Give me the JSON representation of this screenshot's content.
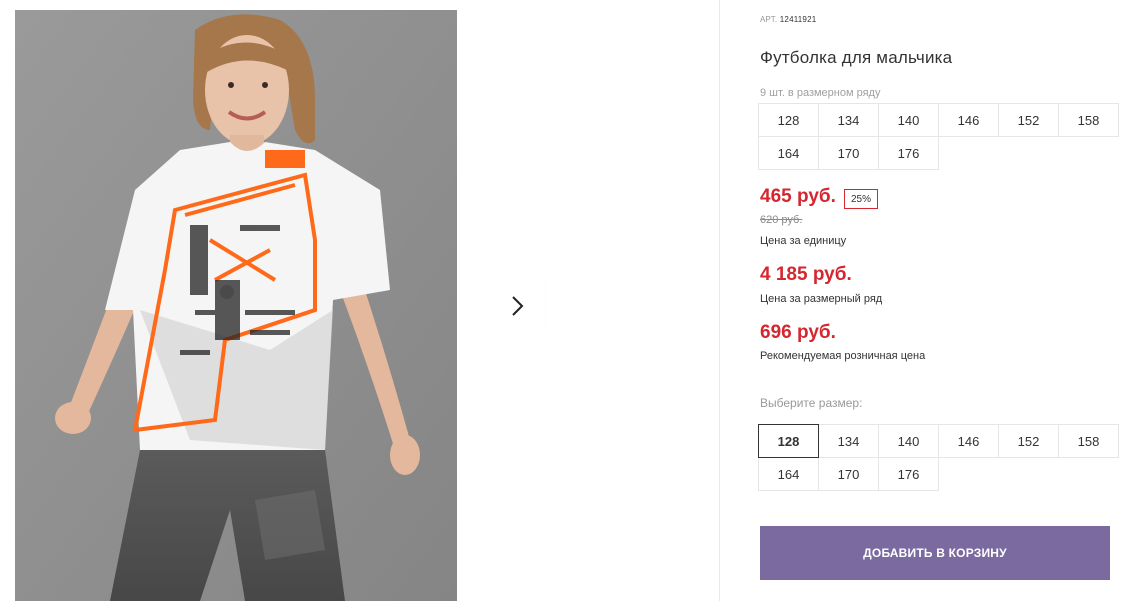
{
  "product": {
    "article_label": "АРТ.",
    "article_number": "12411921",
    "title": "Футболка для мальчика",
    "pack_count_label": "9 шт. в размерном ряду",
    "pack_sizes": [
      "128",
      "134",
      "140",
      "146",
      "152",
      "158",
      "164",
      "170",
      "176"
    ]
  },
  "prices": {
    "unit_price": "465 руб.",
    "discount": "25%",
    "old_price": "620 руб.",
    "unit_label": "Цена за единицу",
    "pack_price": "4 185 руб.",
    "pack_label": "Цена за размерный ряд",
    "retail_price": "696 руб.",
    "retail_label": "Рекомендуемая розничная цена"
  },
  "size_select": {
    "label": "Выберите размер:",
    "options": [
      "128",
      "134",
      "140",
      "146",
      "152",
      "158",
      "164",
      "170",
      "176"
    ],
    "selected": "128"
  },
  "actions": {
    "add_to_cart": "ДОБАВИТЬ В КОРЗИНУ"
  },
  "gallery": {
    "next_icon": "chevron-right-icon"
  },
  "colors": {
    "price_red": "#d6262f",
    "button_purple": "#7b6aa0",
    "tshirt_accent_orange": "#ff6a1a"
  }
}
